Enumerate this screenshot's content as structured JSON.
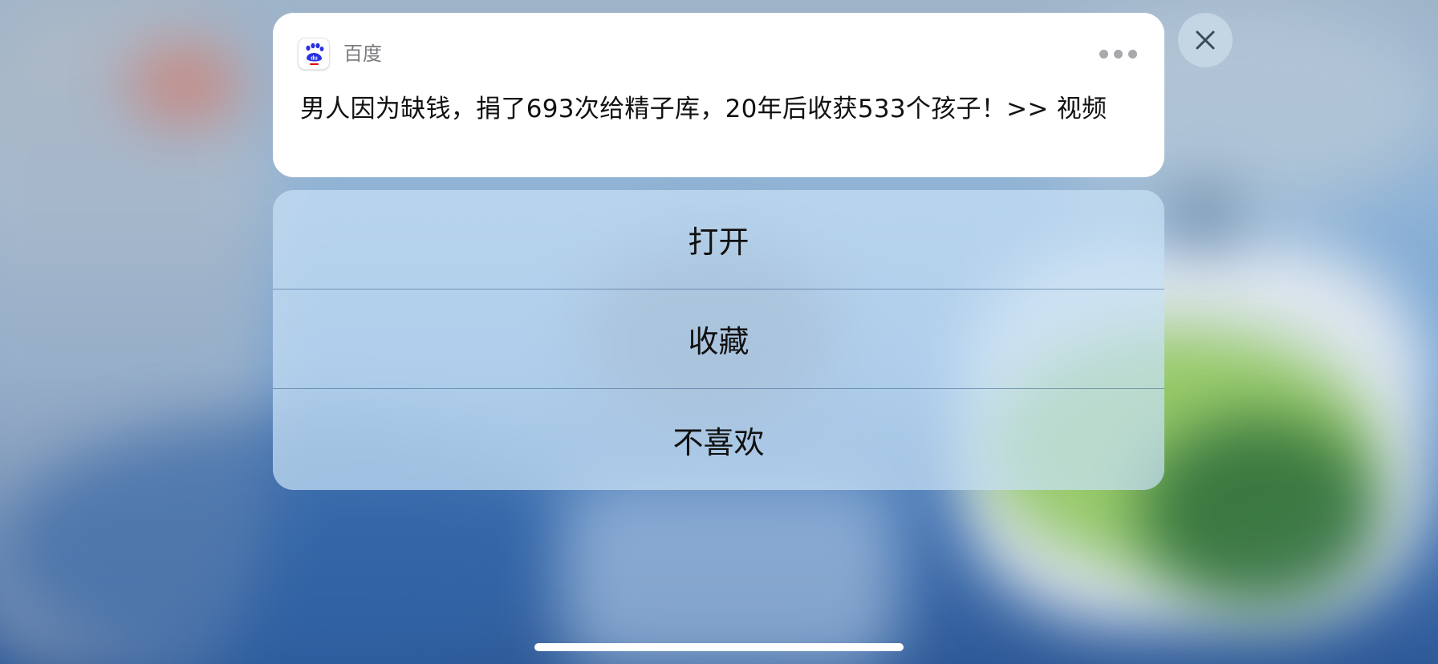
{
  "notification": {
    "app_name": "百度",
    "app_icon": "baidu-paw-icon",
    "message": "男人因为缺钱，捐了693次给精子库，20年后收获533个孩子！>> 视频",
    "more_icon": "more-dots-icon"
  },
  "close_button": {
    "icon": "close-icon"
  },
  "actions": [
    {
      "label": "打开"
    },
    {
      "label": "收藏"
    },
    {
      "label": "不喜欢"
    }
  ],
  "colors": {
    "baidu_blue": "#2932e1",
    "baidu_red": "#e10602"
  }
}
